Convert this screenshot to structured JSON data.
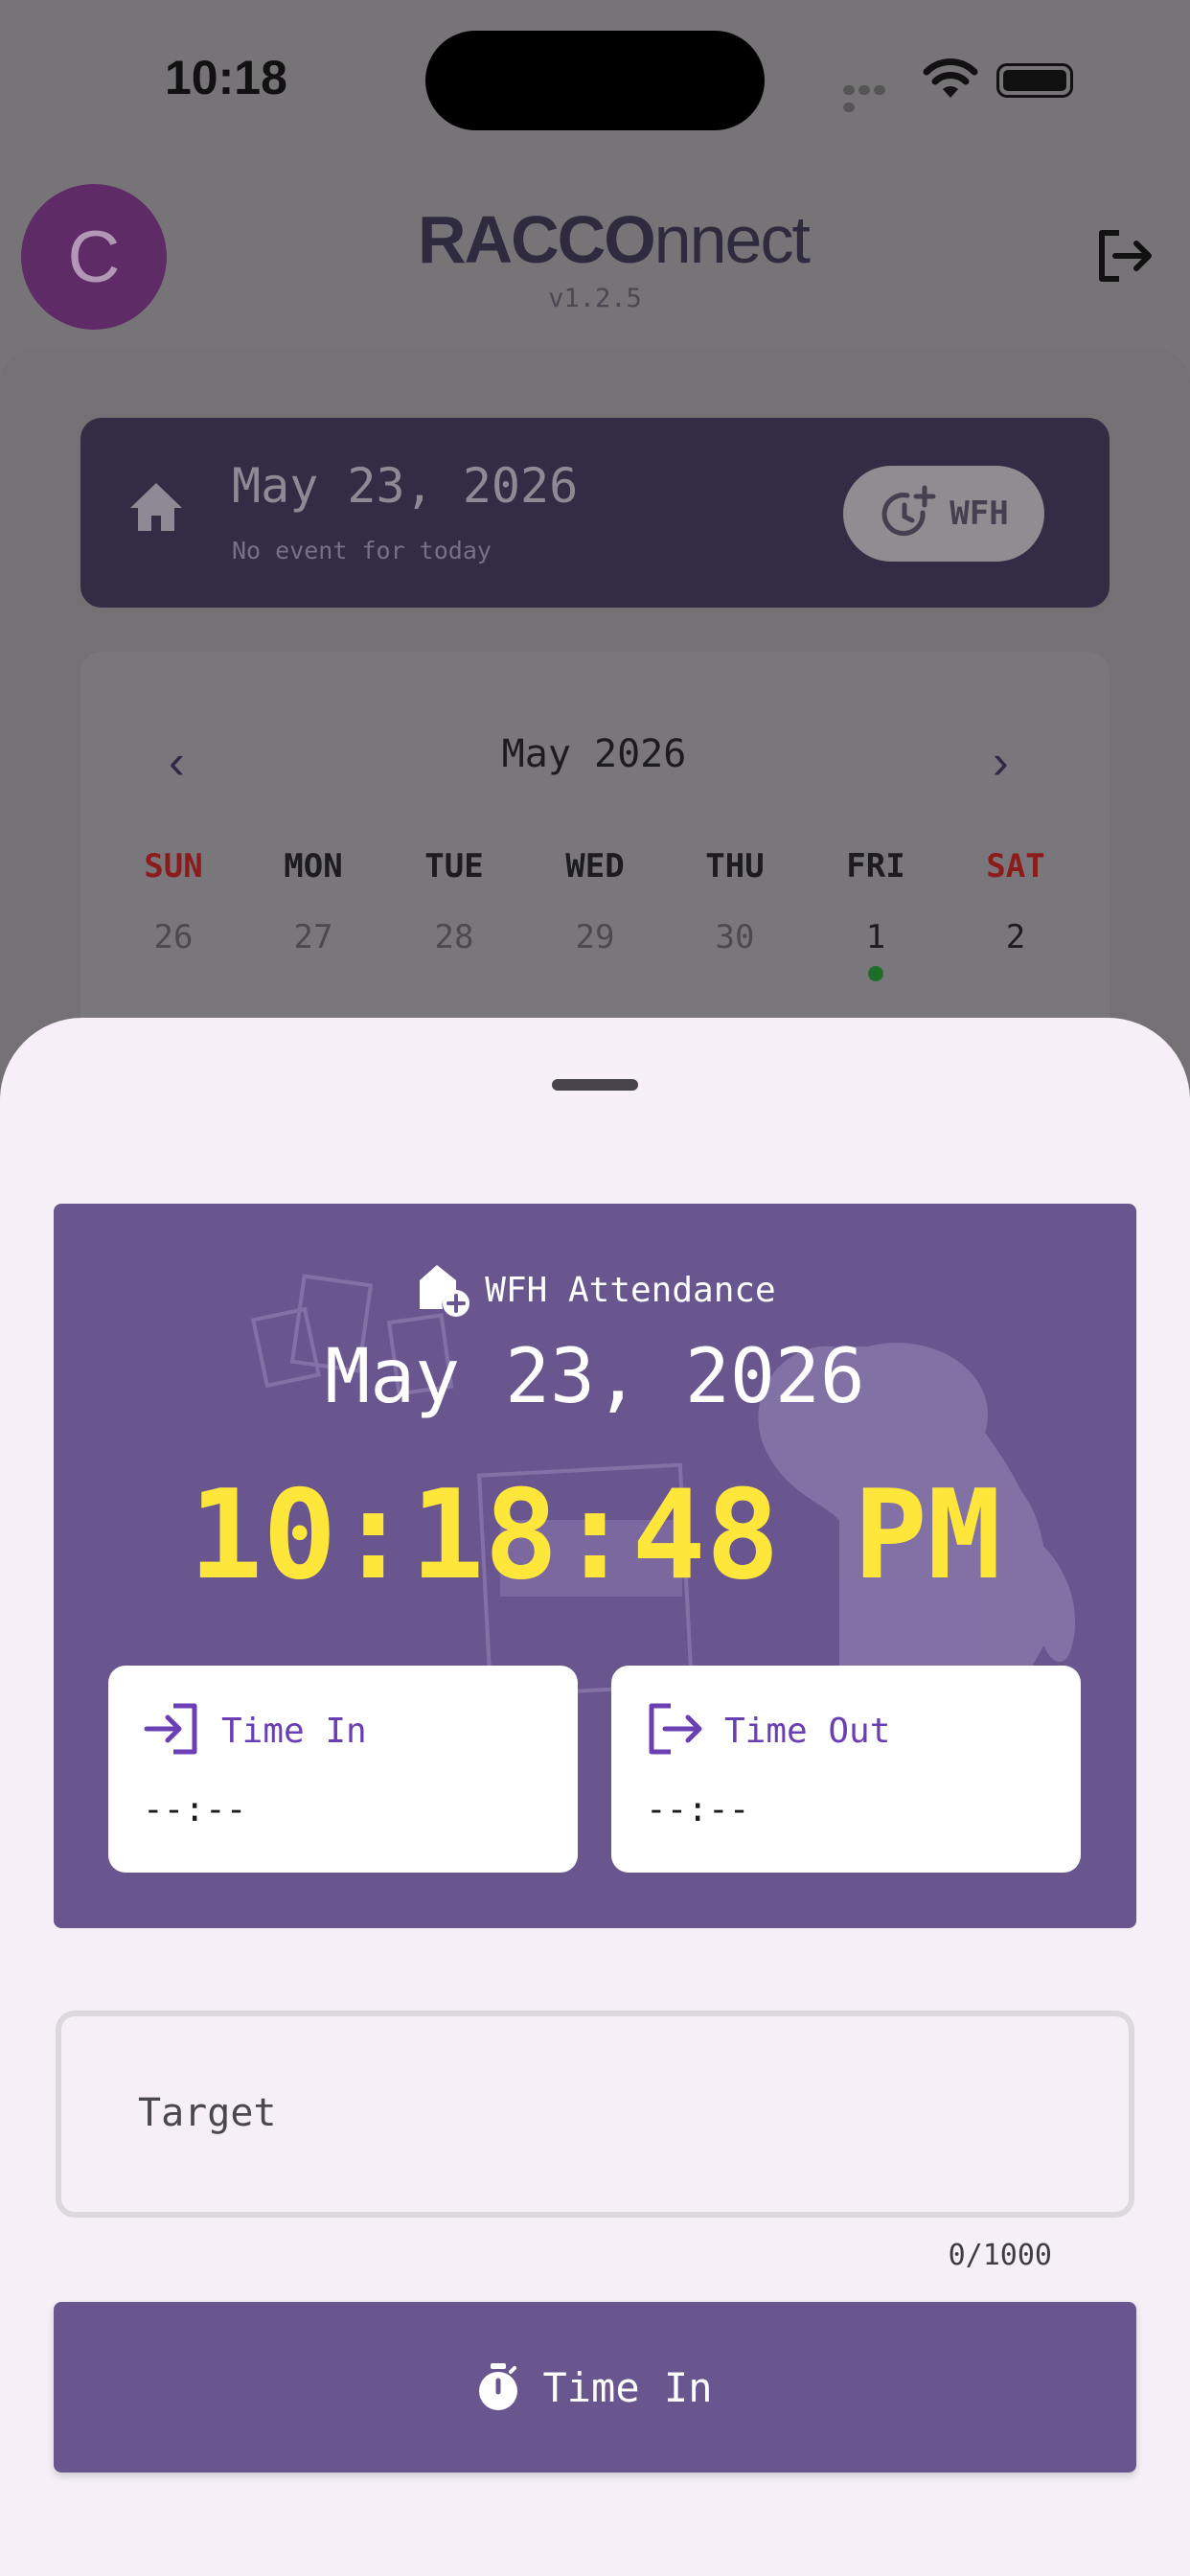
{
  "status_bar": {
    "time": "10:18"
  },
  "header": {
    "avatar_initial": "C",
    "logo_bold": "RACCO",
    "logo_light": "nnect",
    "version": "v1.2.5"
  },
  "today": {
    "date": "May 23, 2026",
    "subtitle": "No event for today",
    "chip_label": "WFH"
  },
  "calendar": {
    "month": "May 2026",
    "weekdays": [
      "SUN",
      "MON",
      "TUE",
      "WED",
      "THU",
      "FRI",
      "SAT"
    ],
    "first_week": [
      "26",
      "27",
      "28",
      "29",
      "30",
      "1",
      "2"
    ]
  },
  "attendance": {
    "title": "WFH Attendance",
    "date": "May 23, 2026",
    "clock": "10:18:48 PM",
    "time_in_label": "Time In",
    "time_in_value": "--:--",
    "time_out_label": "Time Out",
    "time_out_value": "--:--"
  },
  "target": {
    "placeholder": "Target",
    "counter": "0/1000"
  },
  "action": {
    "label": "Time In"
  },
  "colors": {
    "primary": "#6a568f",
    "clock_yellow": "#ffe63b",
    "sheet_bg": "#f6eff7",
    "weekend_red": "#8c1c1c"
  }
}
